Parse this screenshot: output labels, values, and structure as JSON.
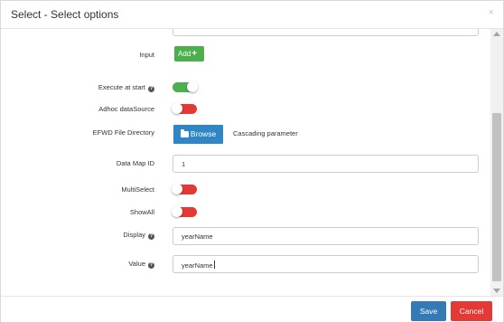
{
  "dialog": {
    "title": "Select - Select options",
    "close_label": "×"
  },
  "form": {
    "input_label": "Input",
    "add_button": "Add",
    "add_plus": "+",
    "execute_label": "Execute at start",
    "execute_on": true,
    "adhoc_label": "Adhoc dataSource",
    "adhoc_on": false,
    "efwd_label": "EFWD File Directory",
    "browse_button": "Browse",
    "cascading_label": "Cascading parameter",
    "datamap_label": "Data Map ID",
    "datamap_value": "1",
    "multiselect_label": "MultiSelect",
    "multiselect_on": false,
    "showall_label": "ShowAll",
    "showall_on": false,
    "display_label": "Display",
    "display_value": "yearName",
    "value_label": "Value",
    "value_value": "yearName",
    "help_glyph": "?"
  },
  "footer": {
    "save_button": "Save",
    "cancel_button": "Cancel"
  },
  "colors": {
    "toggle_on": "#4caf50",
    "toggle_off": "#e53935",
    "primary": "#337ab7",
    "danger": "#e53935",
    "success": "#4cae4c"
  }
}
